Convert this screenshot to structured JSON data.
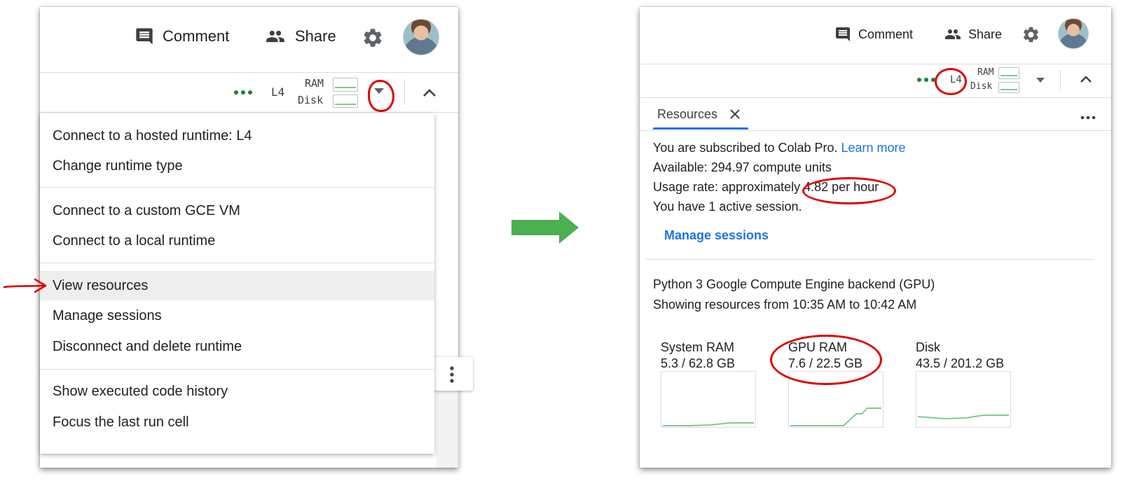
{
  "header": {
    "comment_label": "Comment",
    "share_label": "Share"
  },
  "resource_bar": {
    "accelerator": "L4",
    "ram_label": "RAM",
    "disk_label": "Disk"
  },
  "menu": {
    "items": [
      {
        "label": "Connect to a hosted runtime: L4"
      },
      {
        "label": "Change runtime type"
      },
      {
        "label": "Connect to a custom GCE VM"
      },
      {
        "label": "Connect to a local runtime"
      },
      {
        "label": "View resources",
        "highlighted": true
      },
      {
        "label": "Manage sessions"
      },
      {
        "label": "Disconnect and delete runtime"
      },
      {
        "label": "Show executed code history"
      },
      {
        "label": "Focus the last run cell"
      }
    ]
  },
  "resources": {
    "tab_label": "Resources",
    "subscription_text": "You are subscribed to Colab Pro.",
    "learn_more": "Learn more",
    "available": "Available: 294.97 compute units",
    "usage_prefix": "Usage rate: approximately",
    "usage_value": "4.82 per hour",
    "sessions": "You have 1 active session.",
    "manage_sessions": "Manage sessions",
    "backend": "Python 3 Google Compute Engine backend (GPU)",
    "time_range": "Showing resources from 10:35 AM to 10:42 AM",
    "gauges": [
      {
        "name": "System RAM",
        "value": "5.3 / 62.8 GB"
      },
      {
        "name": "GPU RAM",
        "value": "7.6 / 22.5 GB"
      },
      {
        "name": "Disk",
        "value": "43.5 / 201.2 GB"
      }
    ]
  },
  "colors": {
    "accent": "#1a73e8",
    "status_green": "#188038",
    "arrow_green": "#4caf50",
    "annotation_red": "#e00000",
    "graph_line": "#81c995"
  }
}
